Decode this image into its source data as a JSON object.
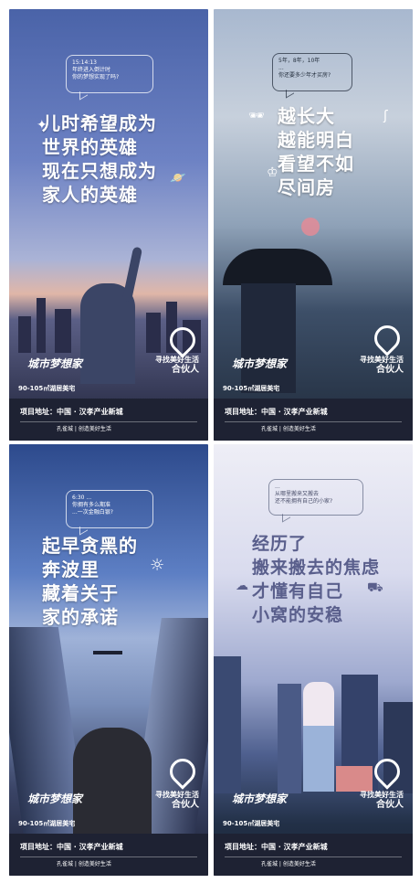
{
  "posters": [
    {
      "bubble": [
        "15:14:13",
        "年终进入倒计时",
        "你的梦想实现了吗?"
      ],
      "headline": [
        "儿时希望成为",
        "世界的英雄",
        "现在只想成为",
        "家人的英雄"
      ],
      "brand": "城市梦想家",
      "slogan_1": "寻找美好生活",
      "slogan_2": "合伙人",
      "area": "90-105㎡湖居美宅",
      "address": "项目地址：中国 · 汉孝产业新城",
      "footer_brand": "孔雀城 | 创造美好生活"
    },
    {
      "bubble": [
        "5年，8年，10年",
        "...",
        "你还要多少年才买房?"
      ],
      "headline": [
        "越长大",
        "越能明白",
        "看望不如",
        "尽间房"
      ],
      "brand": "城市梦想家",
      "slogan_1": "寻找美好生活",
      "slogan_2": "合伙人",
      "area": "90-105㎡湖居美宅",
      "address": "项目地址：中国 · 汉孝产业新城",
      "footer_brand": "孔雀城 | 创造美好生活"
    },
    {
      "bubble": [
        "6:30 ...",
        "你拥有多么期准",
        "...一次金融白银?"
      ],
      "headline": [
        "起早贪黑的",
        "奔波里",
        "藏着关于",
        "家的承诺"
      ],
      "brand": "城市梦想家",
      "slogan_1": "寻找美好生活",
      "slogan_2": "合伙人",
      "area": "90-105㎡湖居美宅",
      "address": "项目地址：中国 · 汉孝产业新城",
      "footer_brand": "孔雀城 | 创造美好生活"
    },
    {
      "bubble": [
        "...",
        "从哪里搬来又搬去",
        "还不能拥有自己的小家?"
      ],
      "headline": [
        "经历了",
        "搬来搬去的焦虑",
        "才懂有自己",
        "小窝的安稳"
      ],
      "brand": "城市梦想家",
      "slogan_1": "寻找美好生活",
      "slogan_2": "合伙人",
      "area": "90-105㎡湖居美宅",
      "address": "项目地址：中国 · 汉孝产业新城",
      "footer_brand": "孔雀城 | 创造美好生活"
    }
  ]
}
